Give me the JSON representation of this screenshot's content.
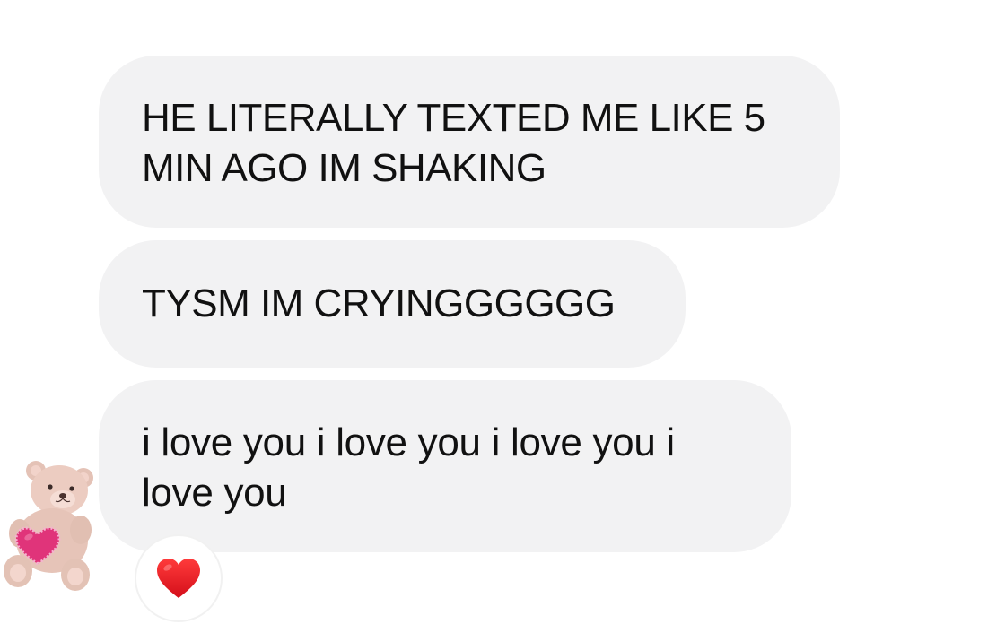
{
  "messages": [
    {
      "text": "HE LITERALLY TEXTED ME LIKE 5 MIN AGO IM SHAKING"
    },
    {
      "text": "TYSM IM CRYINGGGGGG"
    },
    {
      "text": "i love you i love you i love you i love you"
    }
  ],
  "reaction": {
    "emoji": "heart-icon"
  },
  "avatar": {
    "icon": "teddy-bear-heart-icon"
  },
  "colors": {
    "bubble": "#f2f2f3",
    "text": "#111111",
    "heart": "#e0151f"
  }
}
